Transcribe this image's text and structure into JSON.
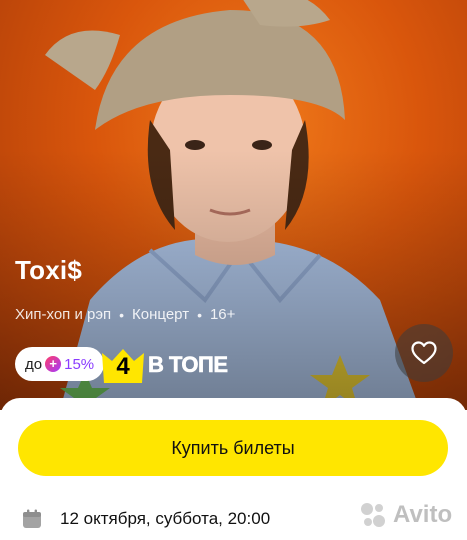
{
  "event": {
    "title": "Toxi$",
    "genre": "Хип-хоп и рэп",
    "type": "Концерт",
    "age": "16+",
    "date_time": "12 октября, суббота, 20:00"
  },
  "badges": {
    "discount_prefix": "до",
    "discount_plus_symbol": "+",
    "discount_value": "15%",
    "top_number": "4",
    "top_label": "В ТОПЕ"
  },
  "actions": {
    "buy_label": "Купить билеты"
  },
  "watermark": {
    "text": "Avito"
  },
  "colors": {
    "hero_background": "#d9560c",
    "buy_button": "#ffe600",
    "top_badge_yellow": "#ffe600",
    "discount_accent": "#8a3cff"
  },
  "icons": {
    "favorite": "heart-icon",
    "calendar": "calendar-icon",
    "watermark": "avito-logo-icon"
  }
}
